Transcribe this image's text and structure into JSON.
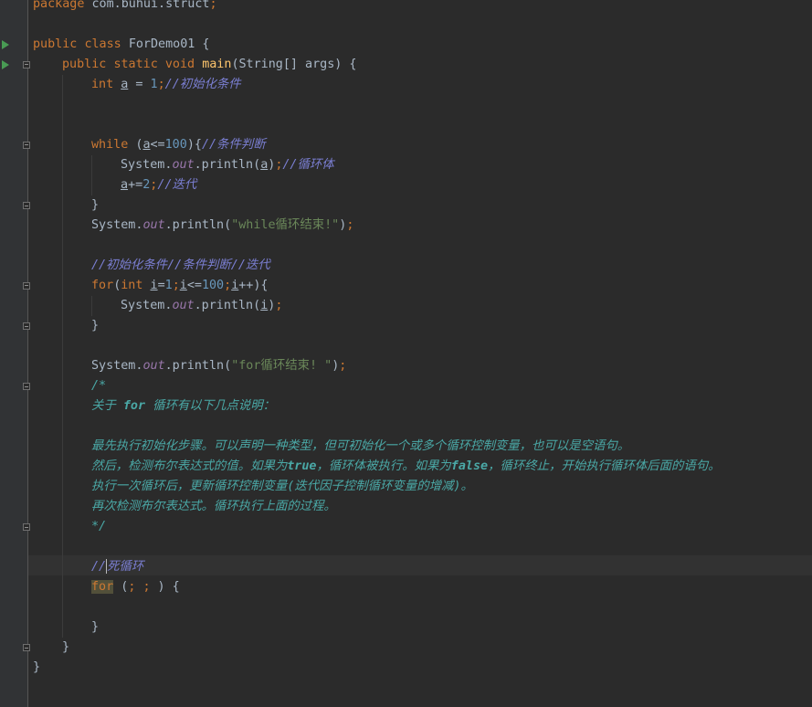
{
  "editor": {
    "lines": [
      {
        "row": 0,
        "indent": 0,
        "tokens": [
          {
            "t": "package ",
            "c": "kw"
          },
          {
            "t": "com.buhui.struct",
            "c": ""
          },
          {
            "t": ";",
            "c": "kw"
          }
        ]
      },
      {
        "row": 2,
        "indent": 0,
        "tokens": [
          {
            "t": "public ",
            "c": "kw"
          },
          {
            "t": "class ",
            "c": "kw"
          },
          {
            "t": "ForDemo01 {",
            "c": ""
          }
        ]
      },
      {
        "row": 3,
        "indent": 1,
        "tokens": [
          {
            "t": "public ",
            "c": "kw"
          },
          {
            "t": "static ",
            "c": "kw"
          },
          {
            "t": "void ",
            "c": "kw"
          },
          {
            "t": "main",
            "c": "fn"
          },
          {
            "t": "(String[] args) {",
            "c": ""
          }
        ]
      },
      {
        "row": 4,
        "indent": 2,
        "tokens": [
          {
            "t": "int ",
            "c": "kw"
          },
          {
            "t": "a",
            "c": "ul"
          },
          {
            "t": " = ",
            "c": ""
          },
          {
            "t": "1",
            "c": "num"
          },
          {
            "t": ";",
            "c": "kw"
          },
          {
            "t": "//初始化条件",
            "c": "blue-cmt"
          }
        ]
      },
      {
        "row": 7,
        "indent": 2,
        "tokens": [
          {
            "t": "while ",
            "c": "kw"
          },
          {
            "t": "(",
            "c": ""
          },
          {
            "t": "a",
            "c": "ul"
          },
          {
            "t": "<=",
            "c": ""
          },
          {
            "t": "100",
            "c": "num"
          },
          {
            "t": "){",
            "c": ""
          },
          {
            "t": "//条件判断",
            "c": "blue-cmt"
          }
        ]
      },
      {
        "row": 8,
        "indent": 3,
        "tokens": [
          {
            "t": "System.",
            "c": ""
          },
          {
            "t": "out",
            "c": "field"
          },
          {
            "t": ".println(",
            "c": ""
          },
          {
            "t": "a",
            "c": "ul"
          },
          {
            "t": ")",
            "c": ""
          },
          {
            "t": ";",
            "c": "kw"
          },
          {
            "t": "//循环体",
            "c": "blue-cmt"
          }
        ]
      },
      {
        "row": 9,
        "indent": 3,
        "tokens": [
          {
            "t": "a",
            "c": "ul"
          },
          {
            "t": "+=",
            "c": ""
          },
          {
            "t": "2",
            "c": "num"
          },
          {
            "t": ";",
            "c": "kw"
          },
          {
            "t": "//迭代",
            "c": "blue-cmt"
          }
        ]
      },
      {
        "row": 10,
        "indent": 2,
        "tokens": [
          {
            "t": "}",
            "c": ""
          }
        ]
      },
      {
        "row": 11,
        "indent": 2,
        "tokens": [
          {
            "t": "System.",
            "c": ""
          },
          {
            "t": "out",
            "c": "field"
          },
          {
            "t": ".println(",
            "c": ""
          },
          {
            "t": "\"while循环结束!\"",
            "c": "str"
          },
          {
            "t": ")",
            "c": ""
          },
          {
            "t": ";",
            "c": "kw"
          }
        ]
      },
      {
        "row": 13,
        "indent": 2,
        "tokens": [
          {
            "t": "//初始化条件//条件判断//迭代",
            "c": "blue-cmt"
          }
        ]
      },
      {
        "row": 14,
        "indent": 2,
        "tokens": [
          {
            "t": "for",
            "c": "kw"
          },
          {
            "t": "(",
            "c": ""
          },
          {
            "t": "int ",
            "c": "kw"
          },
          {
            "t": "i",
            "c": "ul"
          },
          {
            "t": "=",
            "c": ""
          },
          {
            "t": "1",
            "c": "num"
          },
          {
            "t": ";",
            "c": "kw"
          },
          {
            "t": "i",
            "c": "ul"
          },
          {
            "t": "<=",
            "c": ""
          },
          {
            "t": "100",
            "c": "num"
          },
          {
            "t": ";",
            "c": "kw"
          },
          {
            "t": "i",
            "c": "ul"
          },
          {
            "t": "++){",
            "c": ""
          }
        ]
      },
      {
        "row": 15,
        "indent": 3,
        "tokens": [
          {
            "t": "System.",
            "c": ""
          },
          {
            "t": "out",
            "c": "field"
          },
          {
            "t": ".println(",
            "c": ""
          },
          {
            "t": "i",
            "c": "ul"
          },
          {
            "t": ")",
            "c": ""
          },
          {
            "t": ";",
            "c": "kw"
          }
        ]
      },
      {
        "row": 16,
        "indent": 2,
        "tokens": [
          {
            "t": "}",
            "c": ""
          }
        ]
      },
      {
        "row": 18,
        "indent": 2,
        "tokens": [
          {
            "t": "System.",
            "c": ""
          },
          {
            "t": "out",
            "c": "field"
          },
          {
            "t": ".println(",
            "c": ""
          },
          {
            "t": "\"for循环结束! \"",
            "c": "str"
          },
          {
            "t": ")",
            "c": ""
          },
          {
            "t": ";",
            "c": "kw"
          }
        ]
      },
      {
        "row": 19,
        "indent": 2,
        "tokens": [
          {
            "t": "/*",
            "c": "teal"
          }
        ]
      },
      {
        "row": 20,
        "indent": 2,
        "tokens": [
          {
            "t": "关于 ",
            "c": "teal"
          },
          {
            "t": "for",
            "c": "teal-b"
          },
          {
            "t": " 循环有以下几点说明：",
            "c": "teal"
          }
        ]
      },
      {
        "row": 22,
        "indent": 2,
        "tokens": [
          {
            "t": "最先执行初始化步骤。可以声明一种类型，但可初始化一个或多个循环控制变量，也可以是空语句。",
            "c": "teal"
          }
        ]
      },
      {
        "row": 23,
        "indent": 2,
        "tokens": [
          {
            "t": "然后，检测布尔表达式的值。如果为",
            "c": "teal"
          },
          {
            "t": "true",
            "c": "teal-b"
          },
          {
            "t": "，循环体被执行。如果为",
            "c": "teal"
          },
          {
            "t": "false",
            "c": "teal-b"
          },
          {
            "t": "，循环终止，开始执行循环体后面的语句。",
            "c": "teal"
          }
        ]
      },
      {
        "row": 24,
        "indent": 2,
        "tokens": [
          {
            "t": "执行一次循环后，更新循环控制变量(迭代因子控制循环变量的增减)。",
            "c": "teal"
          }
        ]
      },
      {
        "row": 25,
        "indent": 2,
        "tokens": [
          {
            "t": "再次检测布尔表达式。循环执行上面的过程。",
            "c": "teal"
          }
        ]
      },
      {
        "row": 26,
        "indent": 2,
        "tokens": [
          {
            "t": "*/",
            "c": "teal"
          }
        ]
      },
      {
        "row": 28,
        "indent": 2,
        "tokens": [
          {
            "t": "//",
            "c": "blue-cmt"
          },
          {
            "t": "|",
            "c": "caret"
          },
          {
            "t": "死循环",
            "c": "blue-cmt"
          }
        ]
      },
      {
        "row": 29,
        "indent": 2,
        "tokens": [
          {
            "t": "for",
            "c": "hl-for"
          },
          {
            "t": " (",
            "c": ""
          },
          {
            "t": ";",
            "c": "kw"
          },
          {
            "t": " ",
            "c": ""
          },
          {
            "t": ";",
            "c": "kw"
          },
          {
            "t": " ) {",
            "c": ""
          }
        ]
      },
      {
        "row": 31,
        "indent": 2,
        "tokens": [
          {
            "t": "}",
            "c": ""
          }
        ]
      },
      {
        "row": 32,
        "indent": 1,
        "tokens": [
          {
            "t": "}",
            "c": ""
          }
        ]
      },
      {
        "row": 33,
        "indent": 0,
        "tokens": [
          {
            "t": "}",
            "c": ""
          }
        ]
      }
    ]
  },
  "gutter": {
    "run_markers": [
      2,
      3
    ],
    "fold_open": [
      3,
      7,
      14
    ],
    "fold_close": [
      10,
      16,
      19,
      26,
      32
    ]
  }
}
